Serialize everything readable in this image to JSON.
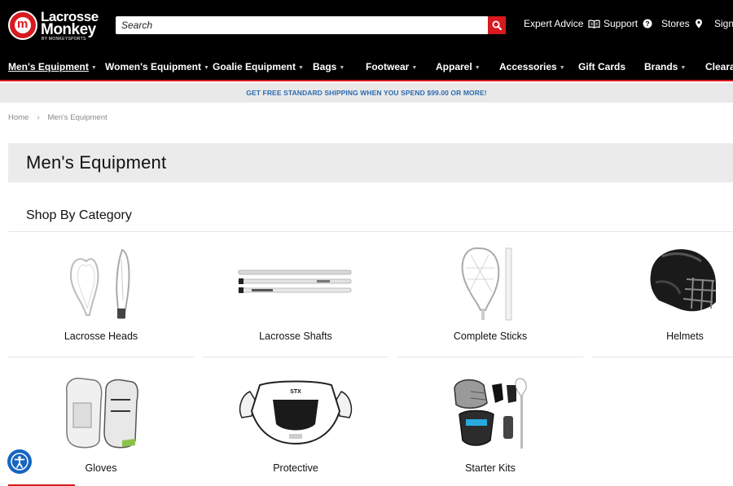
{
  "header": {
    "logo": {
      "line1": "Lacrosse",
      "line2": "Monkey",
      "line3": "BY MONKEYSPORTS"
    },
    "search": {
      "placeholder": "Search"
    },
    "utility": [
      {
        "label": "Expert Advice",
        "icon": "book-icon"
      },
      {
        "label": "Support",
        "icon": "question-icon"
      },
      {
        "label": "Stores",
        "icon": "location-pin-icon"
      },
      {
        "label": "Sign",
        "icon": ""
      }
    ]
  },
  "nav": {
    "items": [
      {
        "label": "Men's Equipment",
        "has_caret": true,
        "active": true
      },
      {
        "label": "Women's Equipment",
        "has_caret": true
      },
      {
        "label": "Goalie Equipment",
        "has_caret": true
      },
      {
        "label": "Bags",
        "has_caret": true
      },
      {
        "label": "Footwear",
        "has_caret": true
      },
      {
        "label": "Apparel",
        "has_caret": true
      },
      {
        "label": "Accessories",
        "has_caret": true
      },
      {
        "label": "Gift Cards",
        "has_caret": false
      },
      {
        "label": "Brands",
        "has_caret": true
      },
      {
        "label": "Clearan",
        "has_caret": false
      }
    ]
  },
  "promo": {
    "text": "GET FREE STANDARD SHIPPING WHEN YOU SPEND $99.00 OR MORE!"
  },
  "breadcrumb": {
    "home": "Home",
    "separator": "›",
    "current": "Men's Equipment"
  },
  "page": {
    "title": "Men's Equipment",
    "section_title": "Shop By Category",
    "categories": [
      {
        "label": "Lacrosse Heads",
        "icon": "lacrosse-head-icon"
      },
      {
        "label": "Lacrosse Shafts",
        "icon": "lacrosse-shaft-icon"
      },
      {
        "label": "Complete Sticks",
        "icon": "complete-stick-icon"
      },
      {
        "label": "Helmets",
        "icon": "helmet-icon"
      },
      {
        "label": "Gloves",
        "icon": "gloves-icon"
      },
      {
        "label": "Protective",
        "icon": "shoulder-pads-icon"
      },
      {
        "label": "Starter Kits",
        "icon": "starter-kit-icon"
      }
    ]
  },
  "colors": {
    "brand_red": "#d71920",
    "header_bg": "#000000",
    "promo_text": "#2a6bb0",
    "accessibility_blue": "#1565c0"
  }
}
